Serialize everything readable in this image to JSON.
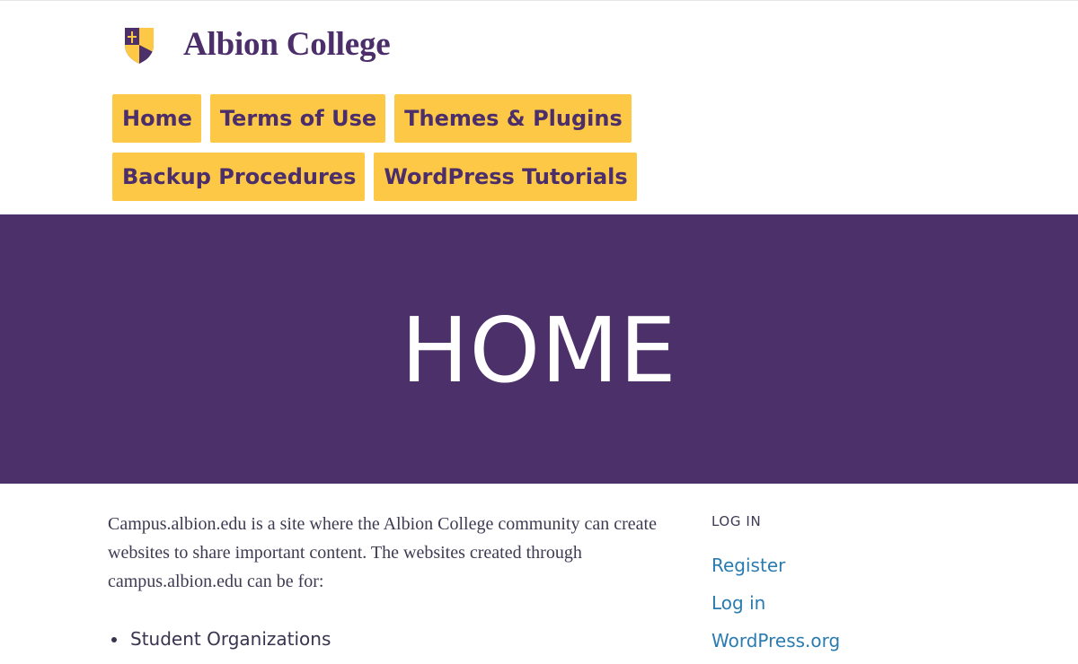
{
  "site": {
    "name": "Albion College",
    "logo_icon": "college-shield-icon",
    "colors": {
      "purple": "#4b306a",
      "gold": "#fcc846",
      "link": "#2a7bb0"
    }
  },
  "nav": {
    "items": [
      {
        "label": "Home"
      },
      {
        "label": "Terms of Use"
      },
      {
        "label": "Themes & Plugins"
      },
      {
        "label": "Backup Procedures"
      },
      {
        "label": "WordPress Tutorials"
      }
    ]
  },
  "hero": {
    "title": "HOME"
  },
  "content": {
    "intro": "Campus.albion.edu is a site where the Albion College community can create websites to share important content. The websites created through campus.albion.edu can be for:",
    "uses": [
      "Student Organizations"
    ]
  },
  "sidebar": {
    "login_widget": {
      "title": "LOG IN",
      "links": [
        {
          "label": "Register"
        },
        {
          "label": "Log in"
        },
        {
          "label": "WordPress.org"
        }
      ]
    }
  }
}
